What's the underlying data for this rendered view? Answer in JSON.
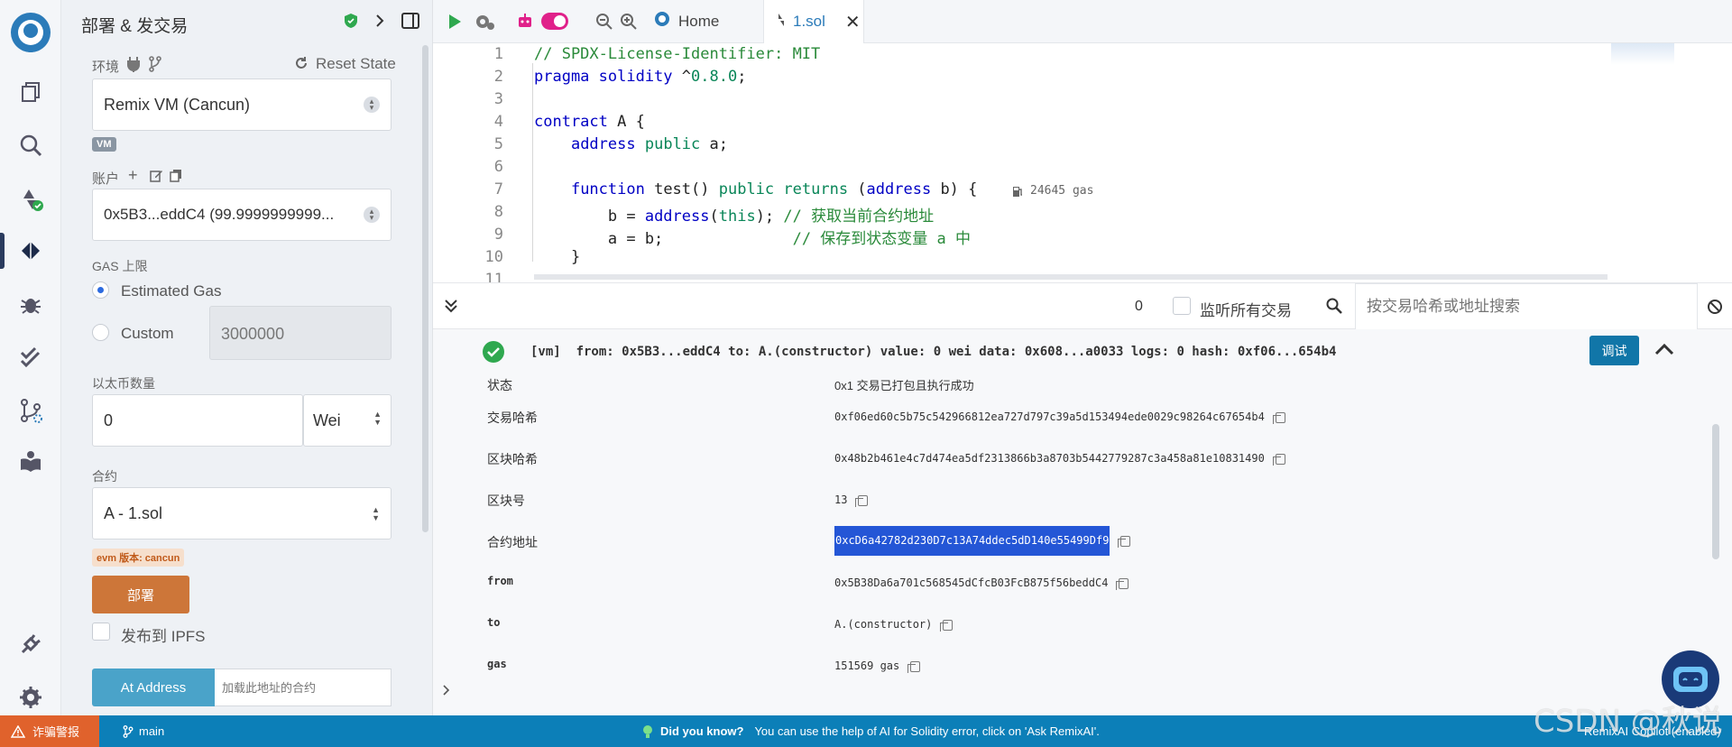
{
  "sidebar_panel": {
    "title": "部署 & 发交易",
    "environment_label": "环境",
    "reset_state": "Reset State",
    "environment_value": "Remix VM (Cancun)",
    "vm_badge": "VM",
    "account_label": "账户",
    "account_value": "0x5B3...eddC4 (99.9999999999...",
    "gas_limit_label": "GAS 上限",
    "estimated_gas": "Estimated Gas",
    "custom": "Custom",
    "custom_gas_value": "3000000",
    "value_label": "以太币数量",
    "value_amount": "0",
    "value_unit": "Wei",
    "contract_label": "合约",
    "contract_value": "A - 1.sol",
    "evm_badge": "evm 版本: cancun",
    "deploy_button": "部署",
    "publish_ipfs": "发布到 IPFS",
    "at_address_button": "At Address",
    "at_address_placeholder": "加载此地址的合约"
  },
  "tabs": {
    "home": "Home",
    "file": "1.sol"
  },
  "editor": {
    "gas_hint": "24645 gas",
    "lines": [
      "1",
      "2",
      "3",
      "4",
      "5",
      "6",
      "7",
      "8",
      "9",
      "10",
      "11"
    ]
  },
  "terminal": {
    "pending_count": "0",
    "listen_all": "监听所有交易",
    "search_placeholder": "按交易哈希或地址搜索",
    "summary": "[vm]  from: 0x5B3...eddC4 to: A.(constructor) value: 0 wei data: 0x608...a0033 logs: 0 hash: 0xf06...654b4",
    "debug_button": "调试",
    "rows": [
      {
        "key": "状态",
        "value": "0x1 交易已打包且执行成功"
      },
      {
        "key": "交易哈希",
        "value": "0xf06ed60c5b75c542966812ea727d797c39a5d153494ede0029c98264c67654b4"
      },
      {
        "key": "区块哈希",
        "value": "0x48b2b461e4c7d474ea5df2313866b3a8703b5442779287c3a458a81e10831490"
      },
      {
        "key": "区块号",
        "value": "13"
      },
      {
        "key": "合约地址",
        "value": "0xcD6a42782d230D7c13A74ddec5dD140e55499Df9"
      },
      {
        "key": "from",
        "value": "0x5B38Da6a701c568545dCfcB03FcB875f56beddC4"
      },
      {
        "key": "to",
        "value": "A.(constructor)"
      },
      {
        "key": "gas",
        "value": "151569 gas"
      }
    ]
  },
  "statusbar": {
    "scam_alert": "诈骗警报",
    "branch": "main",
    "did_you_know": "Did you know?",
    "tip": "You can use the help of AI for Solidity error, click on 'Ask RemixAI'.",
    "copilot": "RemixAI Copilot (enabled)",
    "watermark": "CSDN @秋说"
  },
  "colors": {
    "accent": "#0c7fb8",
    "deploy": "#cd7639",
    "success": "#2fa84f",
    "selection": "#2456d6"
  }
}
